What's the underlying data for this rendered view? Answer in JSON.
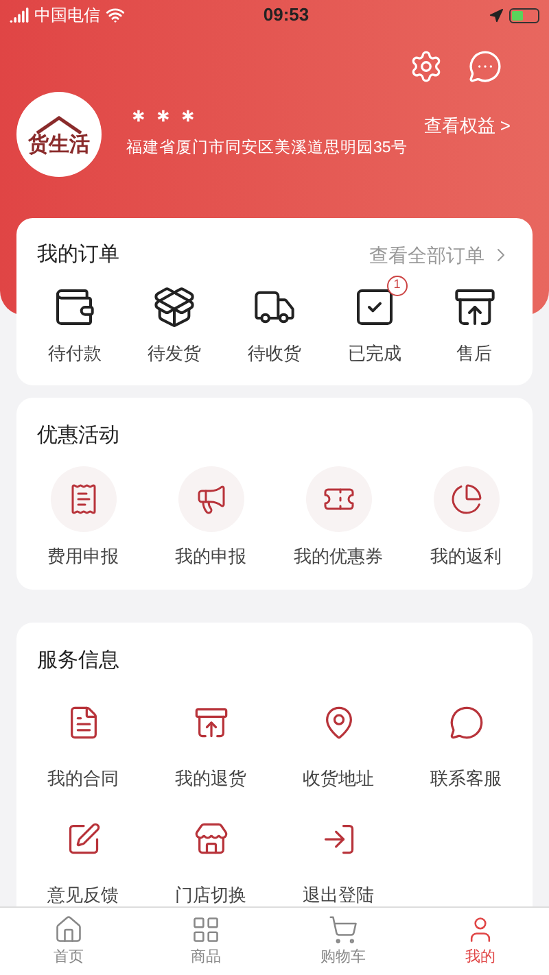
{
  "status_bar": {
    "carrier": "中国电信",
    "time": "09:53"
  },
  "profile": {
    "logo_text": "货生活",
    "name": "＊＊＊",
    "address": "福建省厦门市同安区美溪道思明园35号",
    "link": "查看权益 >"
  },
  "orders": {
    "title": "我的订单",
    "link": "查看全部订单",
    "items": [
      {
        "kind": "wallet",
        "label": "待付款"
      },
      {
        "kind": "box",
        "label": "待发货"
      },
      {
        "kind": "truck",
        "label": "待收货"
      },
      {
        "kind": "done",
        "label": "已完成",
        "badge": "1"
      },
      {
        "kind": "return",
        "label": "售后"
      }
    ]
  },
  "promotions": {
    "title": "优惠活动",
    "items": [
      {
        "kind": "receipt",
        "label": "费用申报"
      },
      {
        "kind": "megaphone",
        "label": "我的申报"
      },
      {
        "kind": "ticket",
        "label": "我的优惠券"
      },
      {
        "kind": "pie",
        "label": "我的返利"
      }
    ]
  },
  "services": {
    "title": "服务信息",
    "items": [
      {
        "kind": "contract",
        "label": "我的合同"
      },
      {
        "kind": "return",
        "label": "我的退货"
      },
      {
        "kind": "address",
        "label": "收货地址"
      },
      {
        "kind": "chat",
        "label": "联系客服"
      },
      {
        "kind": "feedback",
        "label": "意见反馈"
      },
      {
        "kind": "store",
        "label": "门店切换"
      },
      {
        "kind": "logout",
        "label": "退出登陆"
      }
    ]
  },
  "tab_bar": [
    {
      "kind": "home",
      "label": "首页",
      "selected": false
    },
    {
      "kind": "goods",
      "label": "商品",
      "selected": false
    },
    {
      "kind": "cart",
      "label": "购物车",
      "selected": false
    },
    {
      "kind": "me",
      "label": "我的",
      "selected": true
    }
  ]
}
